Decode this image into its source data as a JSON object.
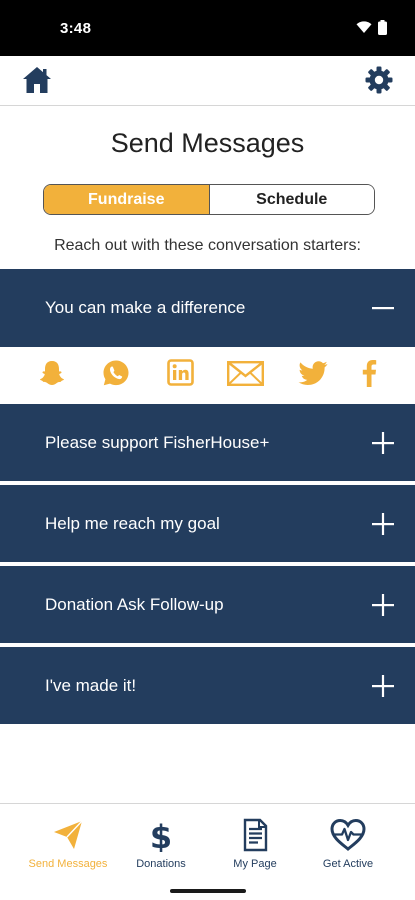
{
  "status_bar": {
    "time": "3:48"
  },
  "header": {
    "title": "Send Messages"
  },
  "tabs": [
    {
      "label": "Fundraise",
      "active": true
    },
    {
      "label": "Schedule",
      "active": false
    }
  ],
  "subtitle": "Reach out with these conversation starters:",
  "starters": [
    {
      "label": "You can make a difference",
      "expanded": true
    },
    {
      "label": "Please support FisherHouse+",
      "expanded": false
    },
    {
      "label": "Help me reach my goal",
      "expanded": false
    },
    {
      "label": "Donation Ask Follow-up",
      "expanded": false
    },
    {
      "label": "I've made it!",
      "expanded": false
    }
  ],
  "share_icons": [
    "snapchat-icon",
    "whatsapp-icon",
    "linkedin-icon",
    "email-icon",
    "twitter-icon",
    "facebook-icon"
  ],
  "bottom_nav": [
    {
      "label": "Send Messages",
      "icon": "paper-plane-icon",
      "active": true
    },
    {
      "label": "Donations",
      "icon": "dollar-icon",
      "active": false
    },
    {
      "label": "My Page",
      "icon": "document-icon",
      "active": false
    },
    {
      "label": "Get Active",
      "icon": "heart-pulse-icon",
      "active": false
    }
  ],
  "colors": {
    "navy": "#233d5e",
    "accent": "#f2b13b",
    "background": "#ffffff"
  }
}
